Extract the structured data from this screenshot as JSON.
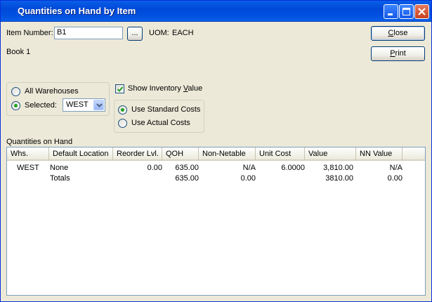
{
  "window": {
    "title": "Quantities on Hand by Item"
  },
  "item": {
    "number_label": "Item Number:",
    "number_value": "B1",
    "lookup_label": "...",
    "uom_label": "UOM:",
    "uom_value": "EACH",
    "description": "Book 1"
  },
  "buttons": {
    "close": {
      "pre": "",
      "key": "C",
      "post": "lose"
    },
    "print": {
      "pre": "",
      "key": "P",
      "post": "rint"
    }
  },
  "warehouse": {
    "all_label": "All Warehouses",
    "selected_label": "Selected:",
    "selected_value": "WEST",
    "selected_option": "selected"
  },
  "inventory_value": {
    "show_label_pre": "Show Inventory ",
    "show_label_key": "V",
    "show_label_post": "alue",
    "checked": true,
    "standard_label": "Use Standard Costs",
    "actual_label": "Use Actual Costs",
    "cost_option": "standard"
  },
  "grid": {
    "caption": "Quantities on Hand",
    "columns": [
      "Whs.",
      "Default Location",
      "Reorder Lvl.",
      "QOH",
      "Non-Netable",
      "Unit Cost",
      "Value",
      "NN Value"
    ],
    "rows": [
      [
        "WEST",
        "None",
        "0.00",
        "635.00",
        "N/A",
        "6.0000",
        "3,810.00",
        "N/A"
      ],
      [
        "",
        "Totals",
        "",
        "635.00",
        "0.00",
        "",
        "3810.00",
        "0.00"
      ]
    ]
  }
}
